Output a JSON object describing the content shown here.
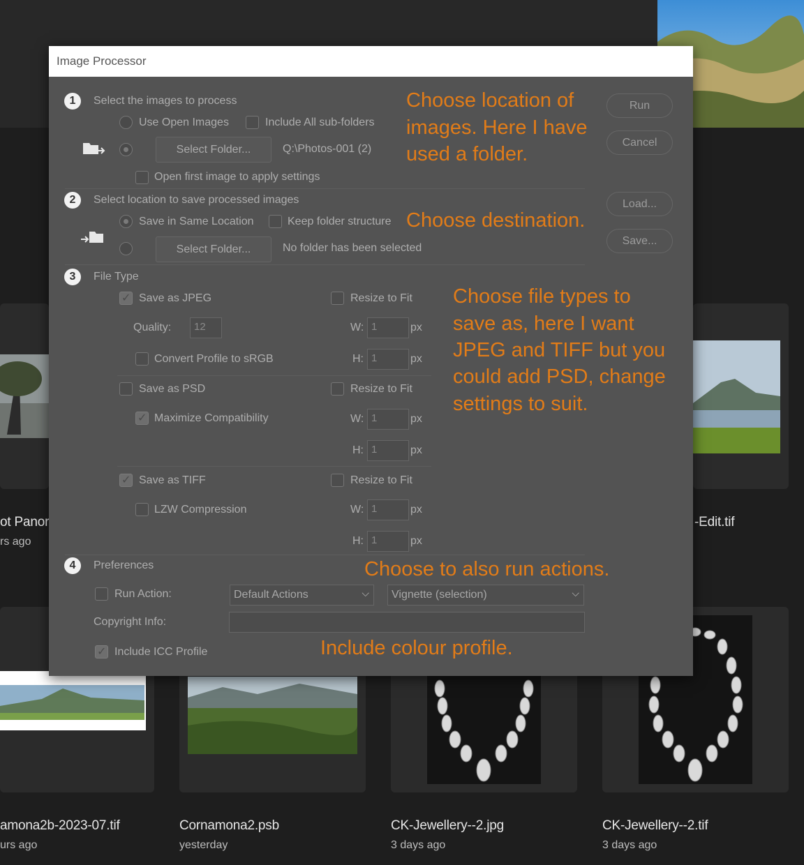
{
  "colors": {
    "annotation": "#e27c18",
    "dialog_bg": "#535353",
    "app_bg": "#1e1e1e"
  },
  "browser": {
    "files": [
      {
        "name": "ot Panora",
        "date": "rs ago"
      },
      {
        "name": "-Edit.tif",
        "date": ""
      },
      {
        "name": "amona2b-2023-07.tif",
        "date": "urs ago"
      },
      {
        "name": "Cornamona2.psb",
        "date": "yesterday"
      },
      {
        "name": "CK-Jewellery--2.jpg",
        "date": "3 days ago"
      },
      {
        "name": "CK-Jewellery--2.tif",
        "date": "3 days ago"
      }
    ]
  },
  "dialog": {
    "title": "Image Processor",
    "section1": {
      "number": "1",
      "title": "Select the images to process",
      "use_open_images": "Use Open Images",
      "include_subfolders": "Include All sub-folders",
      "select_folder_button": "Select Folder...",
      "folder_path": "Q:\\Photos-001 (2)",
      "open_first_image": "Open first image to apply settings"
    },
    "section2": {
      "number": "2",
      "title": "Select location to save processed images",
      "save_same_location": "Save in Same Location",
      "keep_folder_structure": "Keep folder structure",
      "select_folder_button": "Select Folder...",
      "folder_status": "No folder has been selected"
    },
    "section3": {
      "number": "3",
      "title": "File Type",
      "jpeg": {
        "label": "Save as JPEG",
        "checked": true,
        "resize": "Resize to Fit",
        "quality_label": "Quality:",
        "quality": "12",
        "convert_profile": "Convert Profile to sRGB",
        "w_label": "W:",
        "w": "1",
        "h_label": "H:",
        "h": "1",
        "unit": "px"
      },
      "psd": {
        "label": "Save as PSD",
        "checked": false,
        "resize": "Resize to Fit",
        "maximize": "Maximize Compatibility",
        "w_label": "W:",
        "w": "1",
        "h_label": "H:",
        "h": "1",
        "unit": "px"
      },
      "tiff": {
        "label": "Save as TIFF",
        "checked": true,
        "resize": "Resize to Fit",
        "lzw": "LZW Compression",
        "w_label": "W:",
        "w": "1",
        "h_label": "H:",
        "h": "1",
        "unit": "px"
      }
    },
    "section4": {
      "number": "4",
      "title": "Preferences",
      "run_action": "Run Action:",
      "action_set": "Default Actions",
      "action": "Vignette (selection)",
      "copyright_label": "Copyright Info:",
      "copyright_value": "",
      "icc_profile": "Include ICC Profile"
    },
    "buttons": {
      "run": "Run",
      "cancel": "Cancel",
      "load": "Load...",
      "save": "Save..."
    }
  },
  "annotations": {
    "a1_line1": "Choose location of",
    "a1_line2": "images. Here I have",
    "a1_line3": "used a folder.",
    "a2": "Choose destination.",
    "a3_line1": "Choose file types to",
    "a3_line2": "save as, here I want",
    "a3_line3": "JPEG and TIFF but you",
    "a3_line4": "could add PSD, change",
    "a3_line5": "settings to suit.",
    "a4": "Choose to also run actions.",
    "a5": "Include colour profile."
  }
}
